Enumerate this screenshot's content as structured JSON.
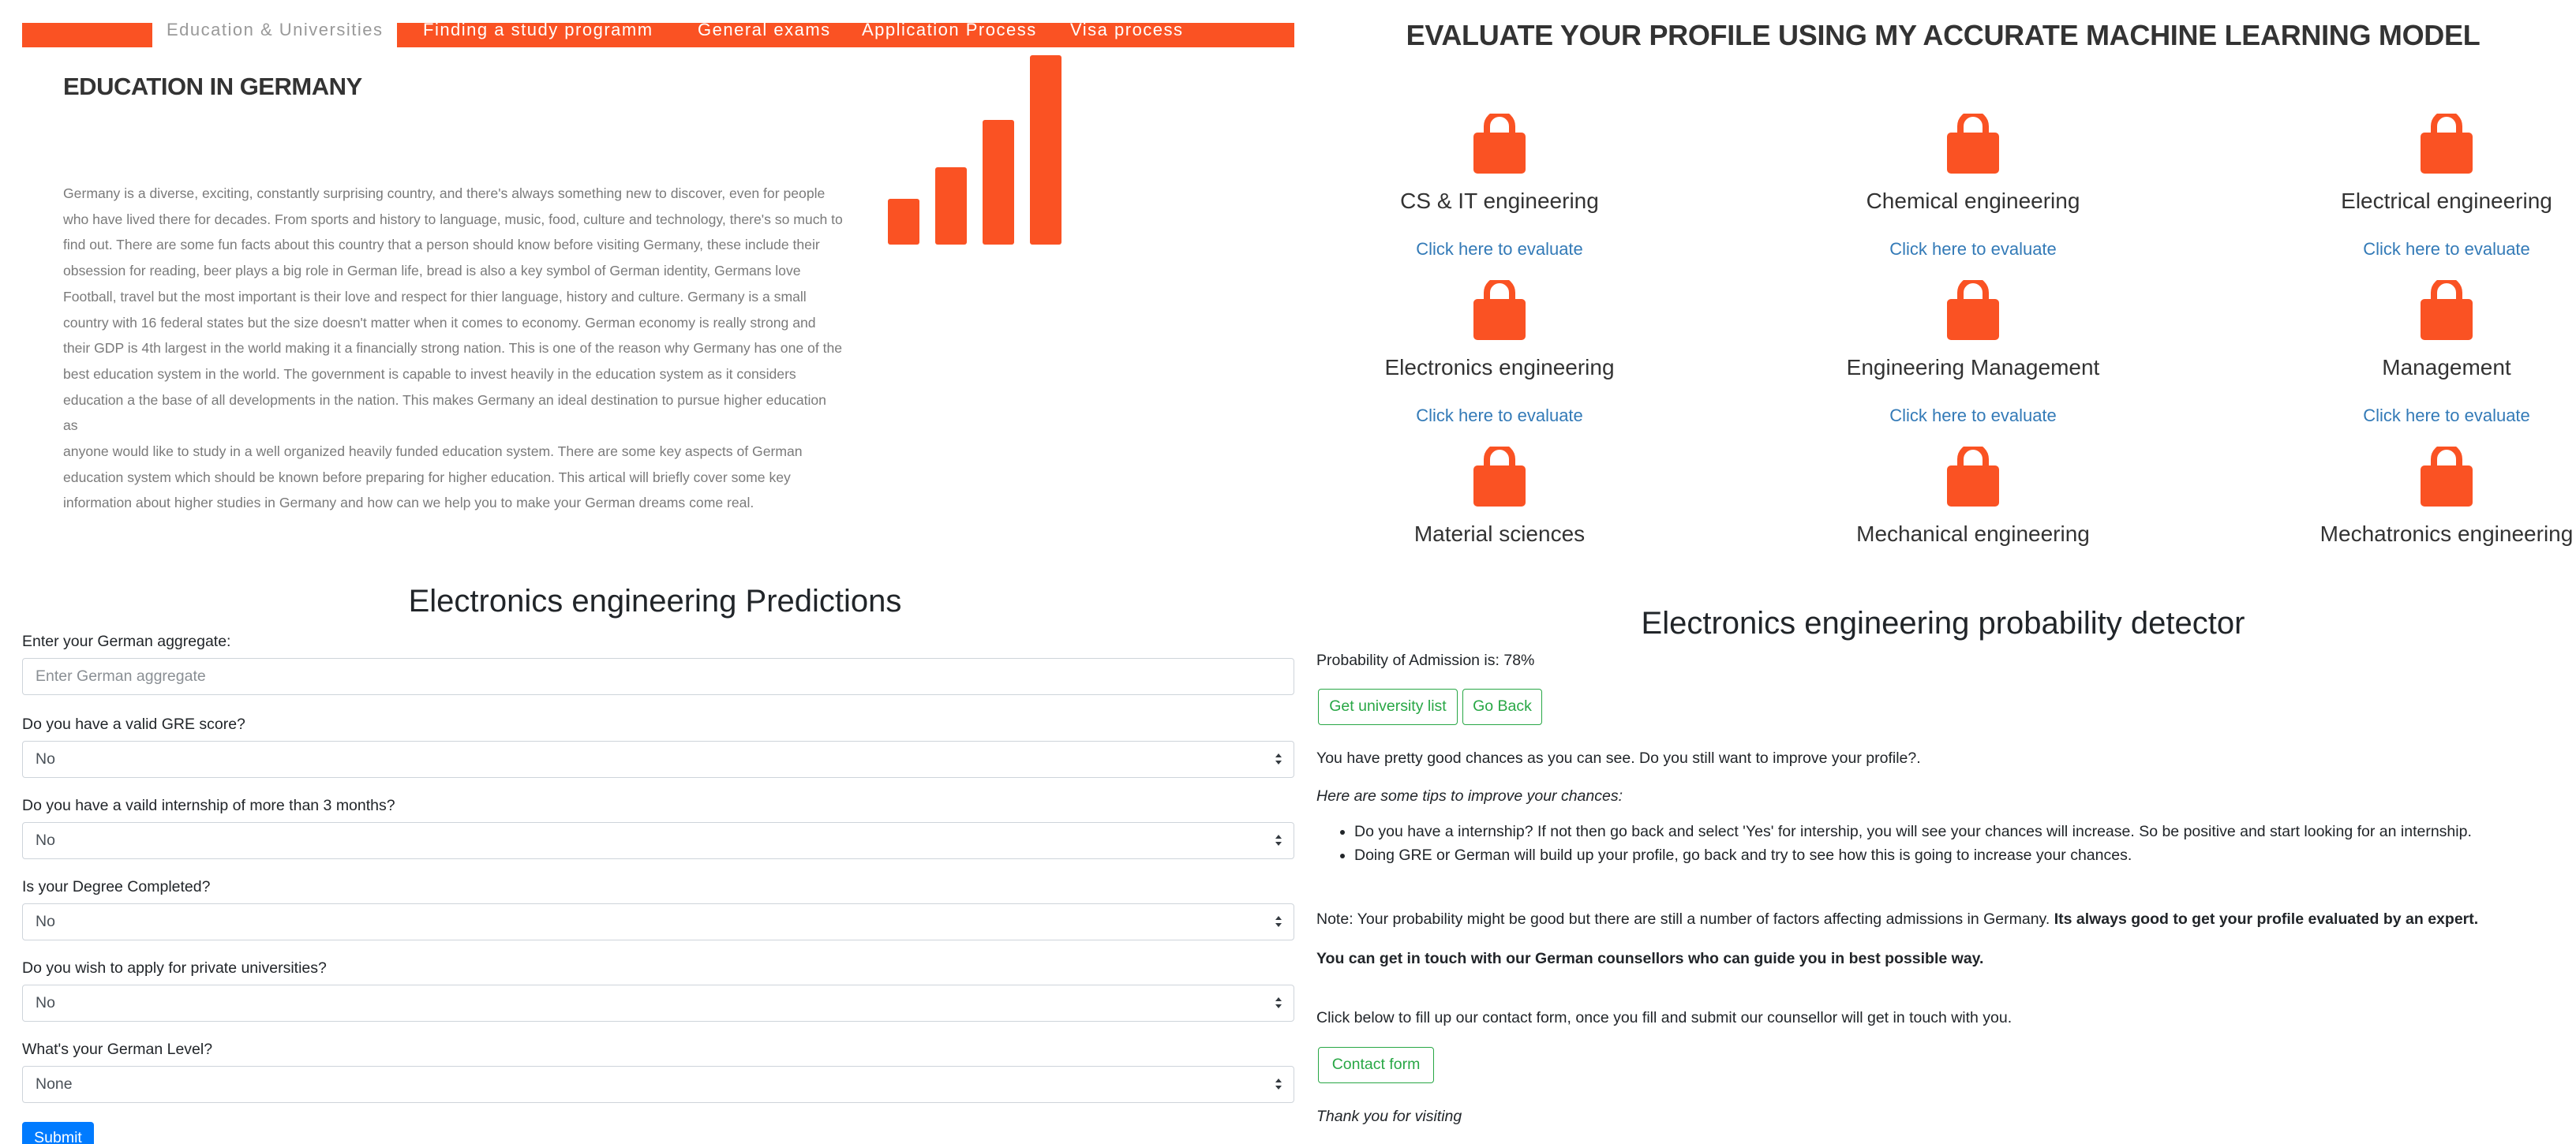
{
  "nav": {
    "items": [
      {
        "label": "Education & Universities",
        "active": true
      },
      {
        "label": "Finding a study programm",
        "active": false
      },
      {
        "label": "General exams",
        "active": false
      },
      {
        "label": "Application Process",
        "active": false
      },
      {
        "label": "Visa process",
        "active": false
      }
    ]
  },
  "education": {
    "title": "EDUCATION IN GERMANY",
    "paragraph_lines": [
      "Germany is a diverse, exciting, constantly surprising country, and there's always something new to discover, even for people",
      "who have lived there for decades. From sports and history to language, music, food, culture and technology, there's so much to",
      "find out. There are some fun facts about this country that a person should know before visiting Germany, these include their",
      "obsession for reading, beer plays a big role in German life, bread is also a key symbol of German identity, Germans love",
      "Football, travel but the most important is their love and respect for thier language, history and culture. Germany is a small",
      "country with 16 federal states but the size doesn't matter when it comes to economy. German economy is really strong and",
      "their GDP is 4th largest in the world making it a financially strong nation. This is one of the reason why Germany has one of the",
      "best education system in the world. The government is capable to invest heavily in the education system as it considers",
      "education a the base of all developments in the nation. This makes Germany an ideal destination to pursue higher education as",
      "anyone would like to study in a well organized heavily funded education system. There are some key aspects of German",
      "education system which should be known before preparing for higher education. This artical will briefly cover some key",
      "information about higher studies in Germany and how can we help you to make your German dreams come real."
    ],
    "icon": "bar-chart-icon",
    "accent": "#fa5223"
  },
  "evaluate": {
    "title": "EVALUATE YOUR PROFILE USING MY ACCURATE MACHINE LEARNING MODEL",
    "link_label": "Click here to evaluate",
    "icon": "lock-icon",
    "courses": [
      "CS & IT engineering",
      "Chemical engineering",
      "Electrical engineering",
      "Electronics engineering",
      "Engineering Management",
      "Management",
      "Material sciences",
      "Mechanical engineering",
      "Mechatronics engineering"
    ]
  },
  "predictions": {
    "title": "Electronics engineering Predictions",
    "aggregate_label": "Enter your German aggregate:",
    "aggregate_placeholder": "Enter German aggregate",
    "selects": [
      {
        "label": "Do you have a valid GRE score?",
        "value": "No"
      },
      {
        "label": "Do you have a vaild internship of more than 3 months?",
        "value": "No"
      },
      {
        "label": "Is your Degree Completed?",
        "value": "No"
      },
      {
        "label": "Do you wish to apply for private universities?",
        "value": "No"
      },
      {
        "label": "What's your German Level?",
        "value": "None"
      }
    ],
    "submit_label": "Submit",
    "button_color": "#007bff"
  },
  "detector": {
    "title": "Electronics engineering probability detector",
    "probability_text": "Probability of Admission is: 78%",
    "university_button": "Get university list",
    "back_button": "Go Back",
    "chances_text": "You have pretty good chances as you can see. Do you still want to improve your profile?.",
    "tips_heading": "Here are some tips to improve your chances:",
    "tips": [
      "Do you have a internship? If not then go back and select 'Yes' for intership, you will see your chances will increase. So be positive and start looking for an internship.",
      "Doing GRE or German will build up your profile, go back and try to see how this is going to increase your chances."
    ],
    "note_plain": "Note: Your probability might be good but there are still a number of factors affecting admissions in Germany. ",
    "note_bold": "Its always good to get your profile evaluated by an expert.",
    "counsellor_text": "You can get in touch with our German counsellors who can guide you in best possible way.",
    "contact_intro": "Click below to fill up our contact form, once you fill and submit our counsellor will get in touch with you.",
    "contact_button": "Contact form",
    "thanks": "Thank you for visiting",
    "button_color": "#28a745"
  }
}
